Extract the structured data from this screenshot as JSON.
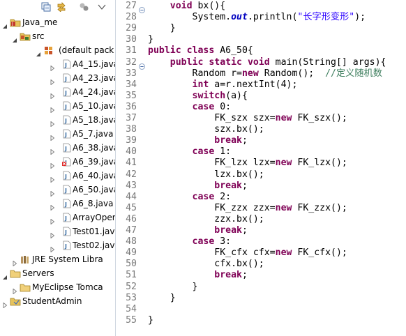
{
  "package_explorer": {
    "toolbar": {
      "collapse_icon": "collapse-all-icon",
      "link_icon": "link-with-editor-icon",
      "view_menu_icon": "view-menu-chevron-icon"
    },
    "tree": [
      {
        "label": "Java_me",
        "icon": "java-project-icon",
        "expanded": true
      },
      {
        "label": "src",
        "icon": "source-folder-icon",
        "expanded": true
      },
      {
        "label": "(default pack",
        "icon": "package-icon",
        "expanded": true
      },
      {
        "label": "A4_15.java",
        "icon": "java-file-icon"
      },
      {
        "label": "A4_23.java",
        "icon": "java-file-icon"
      },
      {
        "label": "A4_24.java",
        "icon": "java-file-icon"
      },
      {
        "label": "A5_10.java",
        "icon": "java-file-icon"
      },
      {
        "label": "A5_18.java",
        "icon": "java-file-icon"
      },
      {
        "label": "A5_7.java",
        "icon": "java-file-icon"
      },
      {
        "label": "A6_38.java",
        "icon": "java-file-icon"
      },
      {
        "label": "A6_39.java",
        "icon": "java-file-error-icon"
      },
      {
        "label": "A6_40.java",
        "icon": "java-file-icon"
      },
      {
        "label": "A6_50.java",
        "icon": "java-file-icon"
      },
      {
        "label": "A6_8.java",
        "icon": "java-file-icon"
      },
      {
        "label": "ArrayOper",
        "icon": "java-file-icon"
      },
      {
        "label": "Test01.java",
        "icon": "java-file-icon"
      },
      {
        "label": "Test02.java",
        "icon": "java-file-icon"
      },
      {
        "label": "JRE System Libra",
        "icon": "library-icon"
      },
      {
        "label": "Servers",
        "icon": "folder-icon",
        "expanded": true
      },
      {
        "label": "MyEclipse Tomca",
        "icon": "folder-icon"
      },
      {
        "label": "StudentAdmin",
        "icon": "project-icon"
      }
    ]
  },
  "editor": {
    "line_numbers": [
      "27",
      "28",
      "29",
      "30",
      "31",
      "32",
      "33",
      "34",
      "35",
      "36",
      "37",
      "38",
      "39",
      "40",
      "41",
      "42",
      "43",
      "44",
      "45",
      "46",
      "47",
      "48",
      "49",
      "50",
      "51",
      "52",
      "53",
      "54",
      "55"
    ],
    "lines": [
      [
        [
          "    ",
          ""
        ],
        [
          "void",
          "kw"
        ],
        [
          " bx(){",
          ""
        ]
      ],
      [
        [
          "        System.",
          ""
        ],
        [
          "out",
          "fld"
        ],
        [
          ".println(",
          ""
        ],
        [
          "\"长字形变形\"",
          "st"
        ],
        [
          ");",
          ""
        ]
      ],
      [
        [
          "    }",
          ""
        ]
      ],
      [
        [
          "}",
          ""
        ]
      ],
      [
        [
          "public",
          "kw"
        ],
        [
          " ",
          ""
        ],
        [
          "class",
          "kw"
        ],
        [
          " A6_50{",
          ""
        ]
      ],
      [
        [
          "    ",
          ""
        ],
        [
          "public",
          "kw"
        ],
        [
          " ",
          ""
        ],
        [
          "static",
          "kw"
        ],
        [
          " ",
          ""
        ],
        [
          "void",
          "kw"
        ],
        [
          " main(String[] args){",
          ""
        ]
      ],
      [
        [
          "        Random r=",
          ""
        ],
        [
          "new",
          "kw"
        ],
        [
          " Random();  ",
          ""
        ],
        [
          "//定义随机数",
          "cm"
        ]
      ],
      [
        [
          "        ",
          ""
        ],
        [
          "int",
          "kw"
        ],
        [
          " a=r.nextInt(4);",
          ""
        ]
      ],
      [
        [
          "        ",
          ""
        ],
        [
          "switch",
          "kw"
        ],
        [
          "(a){",
          ""
        ]
      ],
      [
        [
          "        ",
          ""
        ],
        [
          "case",
          "kw"
        ],
        [
          " 0:",
          ""
        ]
      ],
      [
        [
          "            FK_szx szx=",
          ""
        ],
        [
          "new",
          "kw"
        ],
        [
          " FK_szx();",
          ""
        ]
      ],
      [
        [
          "            szx.bx();",
          ""
        ]
      ],
      [
        [
          "            ",
          ""
        ],
        [
          "break",
          "kw"
        ],
        [
          ";",
          ""
        ]
      ],
      [
        [
          "        ",
          ""
        ],
        [
          "case",
          "kw"
        ],
        [
          " 1:",
          ""
        ]
      ],
      [
        [
          "            FK_lzx lzx=",
          ""
        ],
        [
          "new",
          "kw"
        ],
        [
          " FK_lzx();",
          ""
        ]
      ],
      [
        [
          "            lzx.bx();",
          ""
        ]
      ],
      [
        [
          "            ",
          ""
        ],
        [
          "break",
          "kw"
        ],
        [
          ";",
          ""
        ]
      ],
      [
        [
          "        ",
          ""
        ],
        [
          "case",
          "kw"
        ],
        [
          " 2:",
          ""
        ]
      ],
      [
        [
          "            FK_zzx zzx=",
          ""
        ],
        [
          "new",
          "kw"
        ],
        [
          " FK_zzx();",
          ""
        ]
      ],
      [
        [
          "            zzx.bx();",
          ""
        ]
      ],
      [
        [
          "            ",
          ""
        ],
        [
          "break",
          "kw"
        ],
        [
          ";",
          ""
        ]
      ],
      [
        [
          "        ",
          ""
        ],
        [
          "case",
          "kw"
        ],
        [
          " 3:",
          ""
        ]
      ],
      [
        [
          "            FK_cfx cfx=",
          ""
        ],
        [
          "new",
          "kw"
        ],
        [
          " FK_cfx();",
          ""
        ]
      ],
      [
        [
          "            cfx.bx();",
          ""
        ]
      ],
      [
        [
          "            ",
          ""
        ],
        [
          "break",
          "kw"
        ],
        [
          ";",
          ""
        ]
      ],
      [
        [
          "        }",
          ""
        ]
      ],
      [
        [
          "    }",
          ""
        ]
      ],
      [
        [
          "",
          ""
        ]
      ],
      [
        [
          "}",
          ""
        ]
      ]
    ],
    "fold_markers": [
      "27",
      "32"
    ]
  }
}
